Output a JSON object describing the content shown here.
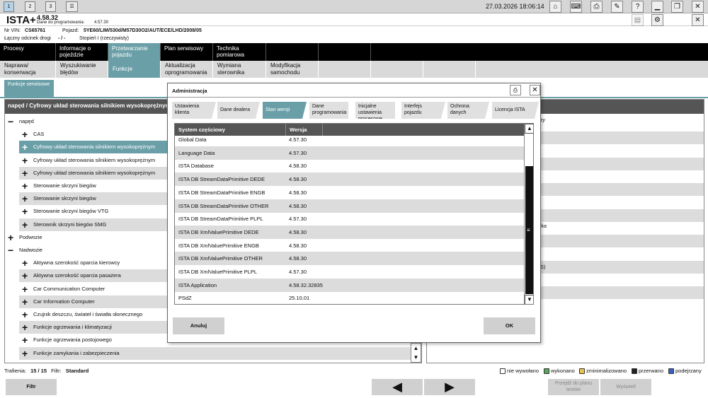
{
  "topbar": {
    "window_buttons": [
      "1",
      "2",
      "3"
    ],
    "datetime": "27.03.2026 18:06:14"
  },
  "title": {
    "app": "ISTA+",
    "version": "4.58.32",
    "data_label": "Dane do programowania:",
    "data_version": "4.57.30"
  },
  "vehicle": {
    "vin_label": "Nr VIN:",
    "vin": "CS65761",
    "vehicle_label": "Pojazd:",
    "vehicle": "5YE60/LIM/530d/M57D30O2/AUT/ECE/LHD/2008/05",
    "distance_label": "Łączny odcinek drogi",
    "distance": "- / -",
    "level": "Stopień I (rzeczywisty)"
  },
  "nav": [
    {
      "label": "Procesy"
    },
    {
      "label": "Informacje o pojeździe"
    },
    {
      "label": "Przetwarzanie pojazdu"
    },
    {
      "label": "Plan serwisowy"
    },
    {
      "label": "Technika pomiarowa"
    }
  ],
  "subnav": [
    {
      "label": "Naprawa/ konserwacja"
    },
    {
      "label": "Wyszukiwanie błędów"
    },
    {
      "label": "Funkcje serwisowe"
    },
    {
      "label": "Aktualizacja oprogramowania"
    },
    {
      "label": "Wymiana sterownika"
    },
    {
      "label": "Modyfikacja samochodu"
    }
  ],
  "section_tab": "Funkcje serwisowe",
  "left_panel": {
    "header": "napęd / Cyfrowy układ sterowania silnikiem wysokoprężnym",
    "rows": [
      {
        "label": "napęd",
        "sign": "−"
      },
      {
        "label": "CAS",
        "sign": "+"
      },
      {
        "label": "Cyfrowy układ sterowania silnikiem wysokoprężnym",
        "sign": "+"
      },
      {
        "label": "Cyfrowy układ sterowania silnikiem wysokoprężnym",
        "sign": "+"
      },
      {
        "label": "Cyfrowy układ sterowania silnikiem wysokoprężnym",
        "sign": "+"
      },
      {
        "label": "Sterowanie skrzyni biegów",
        "sign": "+"
      },
      {
        "label": "Sterowanie skrzyni biegów",
        "sign": "+"
      },
      {
        "label": "Sterowanie skrzyni biegów VTG",
        "sign": "+"
      },
      {
        "label": "Sterownik skrzyni biegów SMG",
        "sign": "+"
      },
      {
        "label": "Podwozie",
        "sign": "+"
      },
      {
        "label": "Nadwozie",
        "sign": "−"
      },
      {
        "label": "Aktywna szerokość oparcia kierowcy",
        "sign": "+"
      },
      {
        "label": "Aktywna szerokość oparcia pasażera",
        "sign": "+"
      },
      {
        "label": "Car Communication Computer",
        "sign": "+"
      },
      {
        "label": "Car Information Computer",
        "sign": "+"
      },
      {
        "label": "Czujnik deszczu, świateł i światła słonecznego",
        "sign": "+"
      },
      {
        "label": "Funkcje ogrzewania i klimatyzacji",
        "sign": "+"
      },
      {
        "label": "Funkcje ogrzewania postojowego",
        "sign": "+"
      },
      {
        "label": "Funkcje zamykania i zabezpieczenia",
        "sign": "+"
      }
    ]
  },
  "right_panel_fragments": [
    "zy",
    "ika",
    "S)"
  ],
  "modal": {
    "title": "Administracja",
    "tabs": [
      "Ustawienia klienta",
      "Dane dealera",
      "Stan wersji",
      "Dane programowania",
      "Inicjalne ustawienia procesowe",
      "Interfejs pojazdu",
      "Ochrona danych",
      "Licencja ISTA"
    ],
    "columns": [
      "System częściowy",
      "Wersja"
    ],
    "rows": [
      [
        "Global Data",
        "4.57.30"
      ],
      [
        "Language Data",
        "4.57.30"
      ],
      [
        "ISTA Database",
        "4.58.30"
      ],
      [
        "ISTA DB StreamDataPrimitive DEDE",
        "4.58.30"
      ],
      [
        "ISTA DB StreamDataPrimitive ENGB",
        "4.58.30"
      ],
      [
        "ISTA DB StreamDataPrimitive OTHER",
        "4.58.30"
      ],
      [
        "ISTA DB StreamDataPrimitive PLPL",
        "4.57.30"
      ],
      [
        "ISTA DB XmlValuePrimitive DEDE",
        "4.58.30"
      ],
      [
        "ISTA DB XmlValuePrimitive ENGB",
        "4.58.30"
      ],
      [
        "ISTA DB XmlValuePrimitive OTHER",
        "4.58.30"
      ],
      [
        "ISTA DB XmlValuePrimitive PLPL",
        "4.57.30"
      ],
      [
        "ISTA Application",
        "4.58.32.32835"
      ],
      [
        "PSdZ",
        "25.10.01"
      ]
    ],
    "cancel": "Anuluj",
    "ok": "OK"
  },
  "status": {
    "hits_label": "Trafienia:",
    "hits": "15 / 15",
    "filter_label": "Filtr:",
    "filter": "Standard"
  },
  "legend": [
    {
      "label": "nie wywołano",
      "color": "#ffffff"
    },
    {
      "label": "wykonano",
      "color": "#58a55c"
    },
    {
      "label": "zminimalizowano",
      "color": "#e8c34a"
    },
    {
      "label": "przerwano",
      "color": "#222222"
    },
    {
      "label": "podejrzany",
      "color": "#3b5fc0"
    }
  ],
  "bottom": {
    "filter": "Filtr",
    "plan": "Przejdź do planu testów",
    "show": "Wyświetl"
  }
}
